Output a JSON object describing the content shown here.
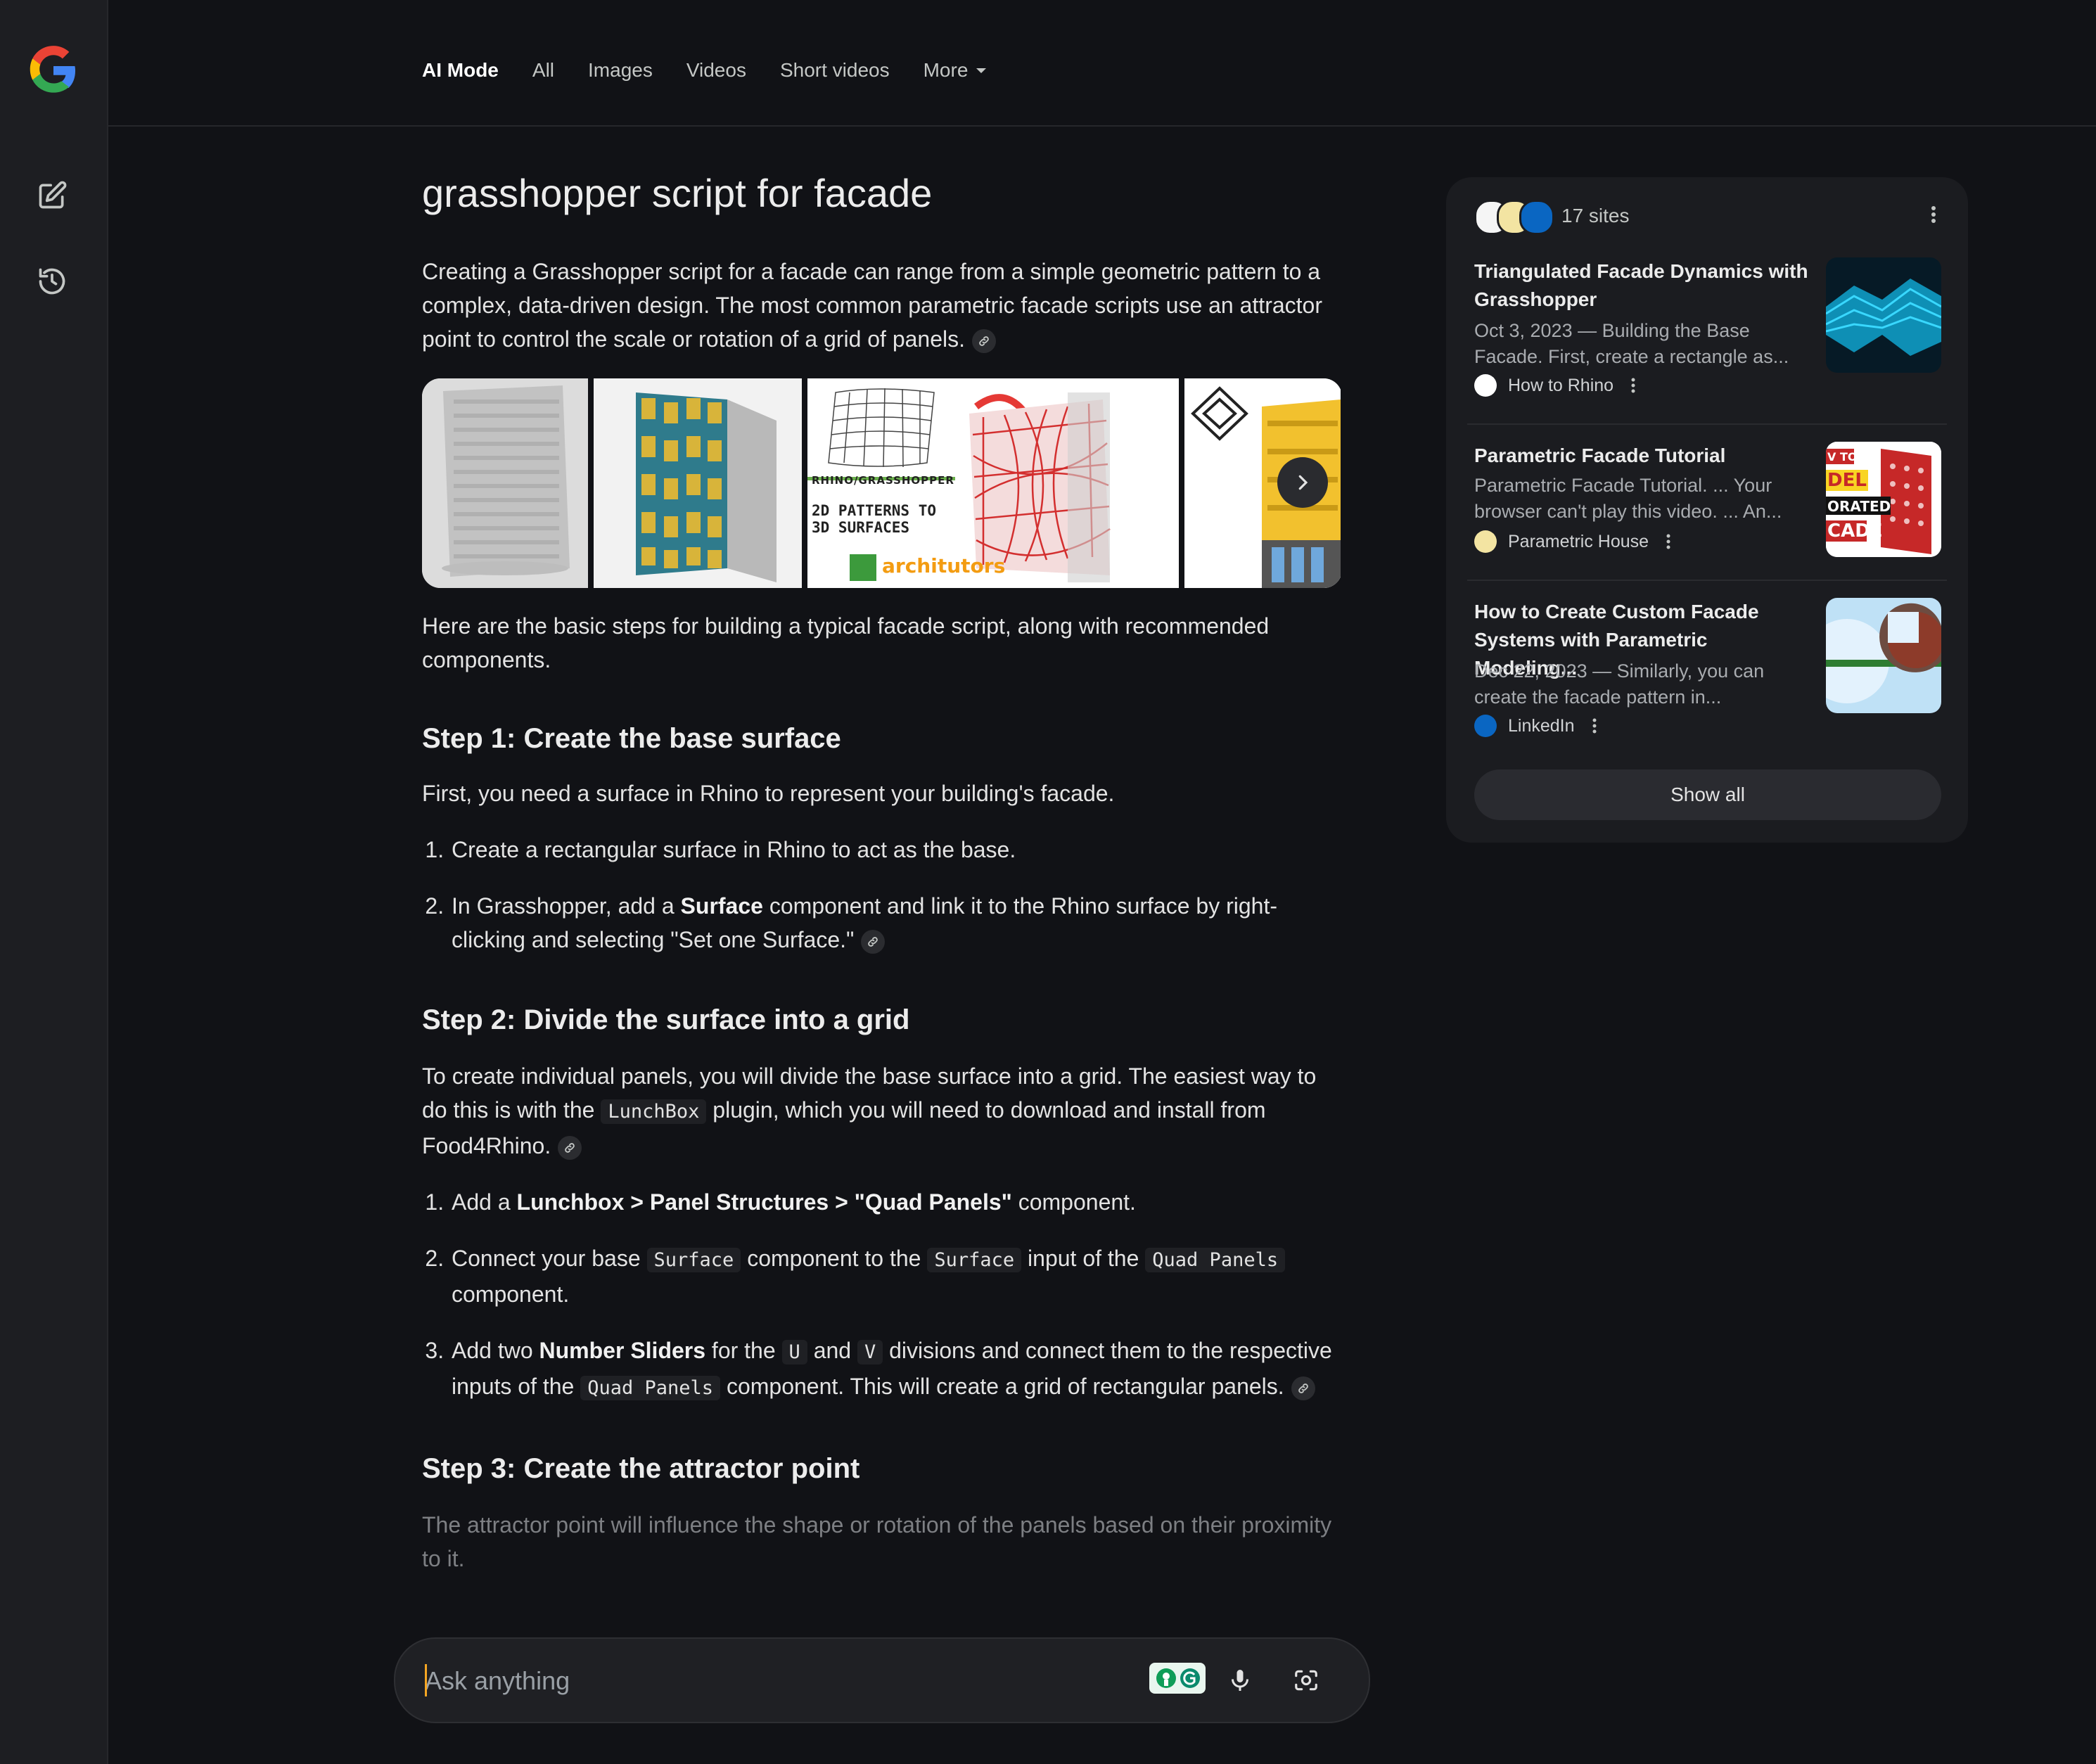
{
  "nav": {
    "tabs": [
      {
        "label": "AI Mode",
        "active": true
      },
      {
        "label": "All"
      },
      {
        "label": "Images"
      },
      {
        "label": "Videos"
      },
      {
        "label": "Short videos"
      },
      {
        "label": "More"
      }
    ]
  },
  "main": {
    "query": "grasshopper script for facade",
    "intro": "Creating a Grasshopper script for a facade can range from a simple geometric pattern to a complex, data-driven design. The most common parametric facade scripts use an attractor point to control the scale or rotation of a grid of panels.",
    "gallery": {
      "image3_text": {
        "line1": "RHINO/GRASSHOPPER",
        "line2": "2D PATTERNS TO",
        "line3": "3D SURFACES",
        "brand": "architutors"
      }
    },
    "steps_intro": "Here are the basic steps for building a typical facade script, along with recommended components.",
    "step1": {
      "heading": "Step 1: Create the base surface",
      "text": "First, you need a surface in Rhino to represent your building's facade.",
      "item1": "Create a rectangular surface in Rhino to act as the base.",
      "item2_a": "In Grasshopper, add a ",
      "item2_b": "Surface",
      "item2_c": " component and link it to the Rhino surface by right-clicking and selecting \"Set one Surface.\""
    },
    "step2": {
      "heading": "Step 2: Divide the surface into a grid",
      "text_a": "To create individual panels, you will divide the base surface into a grid. The easiest way to do this is with the ",
      "text_code": "LunchBox",
      "text_b": " plugin, which you will need to download and install from Food4Rhino.",
      "item1_a": "Add a ",
      "item1_b": "Lunchbox > Panel Structures > \"Quad Panels\"",
      "item1_c": " component.",
      "item2_a": "Connect your base ",
      "item2_code1": "Surface",
      "item2_b": " component to the ",
      "item2_code2": "Surface",
      "item2_c": " input of the ",
      "item2_code3": "Quad Panels",
      "item2_d": " component.",
      "item3_a": "Add two ",
      "item3_b": "Number Sliders",
      "item3_c": " for the ",
      "item3_code1": "U",
      "item3_d": " and ",
      "item3_code2": "V",
      "item3_e": " divisions and connect them to the respective inputs of the ",
      "item3_code3": "Quad Panels",
      "item3_f": " component. This will create a grid of rectangular panels."
    },
    "step3": {
      "heading": "Step 3: Create the attractor point",
      "text": "The attractor point will influence the shape or rotation of the panels based on their proximity to it."
    }
  },
  "ask": {
    "placeholder": "Ask anything"
  },
  "sources": {
    "count_label": "17 sites",
    "items": [
      {
        "title": "Triangulated Facade Dynamics with Grasshopper",
        "snippet": "Oct 3, 2023 — Building the Base Facade. First, create a rectangle as...",
        "site": "How to Rhino"
      },
      {
        "title": "Parametric Facade Tutorial",
        "snippet": "Parametric Facade Tutorial. ... Your browser can't play this video. ... An...",
        "site": "Parametric House",
        "thumb_text": [
          "V TO",
          "DEL",
          "ORATED",
          "CADE"
        ]
      },
      {
        "title": "How to Create Custom Facade Systems with Parametric Modeling...",
        "snippet": "Dec 22, 2023 — Similarly, you can create the facade pattern in...",
        "site": "LinkedIn"
      }
    ],
    "show_all_label": "Show all"
  },
  "colors": {
    "background": "#111216",
    "rail": "#1d1e22",
    "panel": "#1b1c20",
    "text": "#e3e3e3",
    "accent_cursor": "#f5a623"
  }
}
